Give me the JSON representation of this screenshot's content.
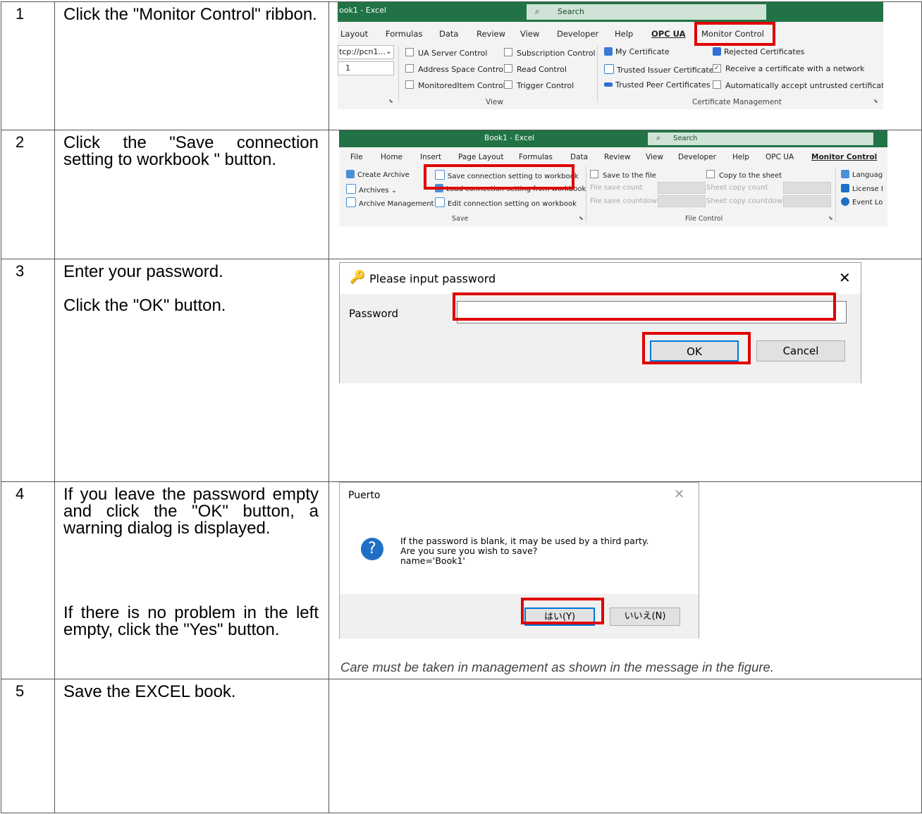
{
  "steps": [
    {
      "num": "1",
      "lines": [
        "Click the \"Monitor Control\" ribbon."
      ]
    },
    {
      "num": "2",
      "lines": [
        "Click the \"Save connection setting to workbook \" button."
      ]
    },
    {
      "num": "3",
      "lines": [
        "Enter your password.",
        "Click the \"OK\" button."
      ]
    },
    {
      "num": "4",
      "lines": [
        "If you leave the password empty and click the \"OK\" button, a warning dialog is displayed.",
        "If there is no problem in the left empty, click the \"Yes\" button."
      ]
    },
    {
      "num": "5",
      "lines": [
        "Save the EXCEL book."
      ]
    }
  ],
  "ribbon1": {
    "title": "ook1 - Excel",
    "search": "Search",
    "tabs": [
      "Layout",
      "Formulas",
      "Data",
      "Review",
      "View",
      "Developer",
      "Help",
      "OPC UA",
      "Monitor Control"
    ],
    "endpoint": "tcp://pcn1...",
    "field2": "1",
    "view_checks": [
      "UA Server Control",
      "Address Space Control",
      "MonitoredItem Control",
      "Subscription Control",
      "Read Control",
      "Trigger Control"
    ],
    "cert_items": [
      "My Certificate",
      "Trusted Issuer Certificates",
      "Trusted Peer Certificates",
      "Rejected Certificates"
    ],
    "cert_checks": [
      "Receive a certificate with a network",
      "Automatically accept untrusted certificate"
    ],
    "group_view": "View",
    "group_cert": "Certificate Management"
  },
  "ribbon2": {
    "title": "Book1 - Excel",
    "search": "Search",
    "tabs": [
      "File",
      "Home",
      "Insert",
      "Page Layout",
      "Formulas",
      "Data",
      "Review",
      "View",
      "Developer",
      "Help",
      "OPC UA",
      "Monitor Control"
    ],
    "save_items": [
      "Create Archive",
      "Archives",
      "Archive Management",
      "Save connection setting to workbook",
      "Load connection setting from workbook",
      "Edit connection setting on workbook"
    ],
    "file_items": [
      "Save to the file",
      "File save count",
      "File save countdown",
      "Copy to the sheet",
      "Sheet copy count",
      "Sheet copy countdown"
    ],
    "right_items": [
      "Languag",
      "License I",
      "Event Lo"
    ],
    "group_save": "Save",
    "group_file": "File Control"
  },
  "dialog3": {
    "title": "Please input password",
    "label": "Password",
    "ok": "OK",
    "cancel": "Cancel"
  },
  "dialog4": {
    "title": "Puerto",
    "message": [
      "If the password is blank, it may be used by a third party.",
      "Are you sure you wish to save?",
      "name='Book1'"
    ],
    "yes": "はい(Y)",
    "no": "いいえ(N)",
    "caption": "Care must be taken in management as shown in the message in the figure."
  },
  "colors": {
    "excel_green": "#217346",
    "highlight_red": "#e00000",
    "question_blue": "#1f6fc5"
  }
}
